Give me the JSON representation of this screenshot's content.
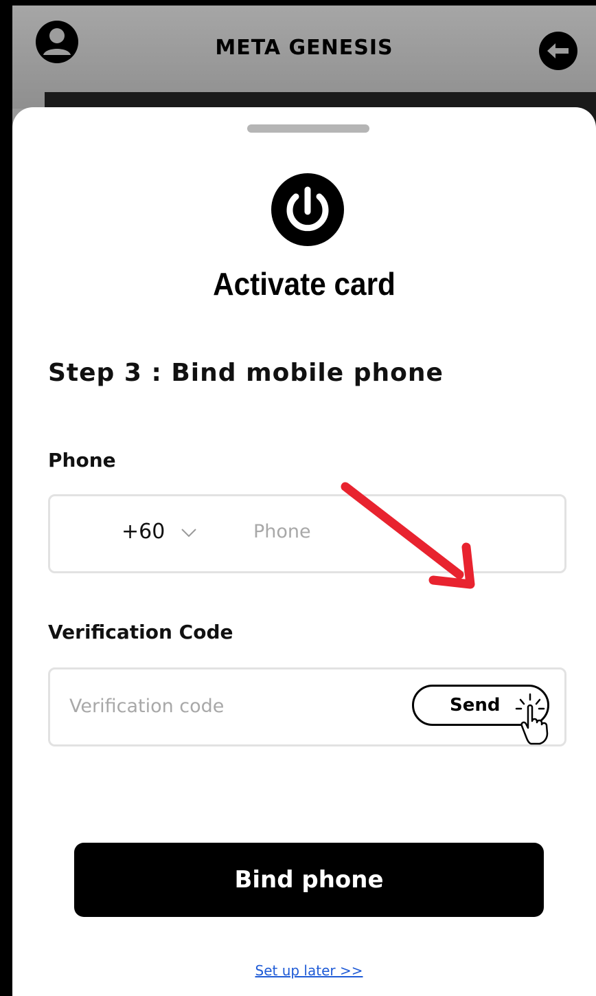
{
  "header": {
    "title": "META GENESIS",
    "avatar_icon": "user-icon",
    "back_icon": "back-arrow-icon"
  },
  "sheet": {
    "power_icon": "power-icon",
    "title": "Activate card",
    "step_title": "Step 3 : Bind mobile phone"
  },
  "phone_field": {
    "label": "Phone",
    "country_code": "+60",
    "placeholder": "Phone"
  },
  "code_field": {
    "label": "Verification Code",
    "placeholder": "Verification code",
    "send_label": "Send"
  },
  "actions": {
    "bind_label": "Bind phone",
    "later_label": "Set up later >>"
  },
  "colors": {
    "accent": "#000000",
    "link": "#1f5bd6",
    "annotation": "#e8232f"
  }
}
